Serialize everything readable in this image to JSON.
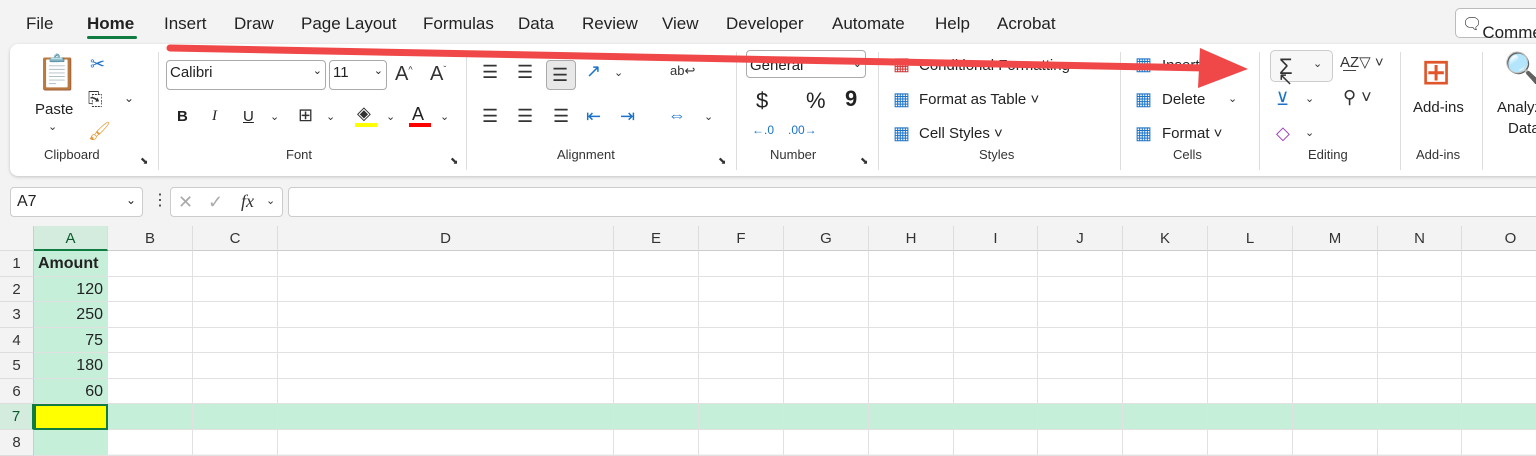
{
  "menu": {
    "tabs": [
      "File",
      "Home",
      "Insert",
      "Draw",
      "Page Layout",
      "Formulas",
      "Data",
      "Review",
      "View",
      "Developer",
      "Automate",
      "Help",
      "Acrobat"
    ],
    "active": "Home",
    "comments": "Comments"
  },
  "ribbon": {
    "clipboard": {
      "label": "Clipboard",
      "paste": "Paste"
    },
    "font": {
      "label": "Font",
      "family": "Calibri",
      "size": "11",
      "bold": "B",
      "italic": "I",
      "underline": "U",
      "font_color": "A",
      "fill_color": "#ffff00",
      "text_color": "#ff0000"
    },
    "alignment": {
      "label": "Alignment"
    },
    "number": {
      "label": "Number",
      "format": "General",
      "currency": "$",
      "percent": "%",
      "comma": "9"
    },
    "styles": {
      "label": "Styles",
      "conditional": "Conditional Formatting",
      "format_table": "Format as Table",
      "cell_styles": "Cell Styles"
    },
    "cells": {
      "label": "Cells",
      "insert": "Insert",
      "delete": "Delete",
      "format": "Format"
    },
    "editing": {
      "label": "Editing",
      "autosum": "Σ"
    },
    "addins": {
      "label": "Add-ins",
      "button": "Add-ins"
    },
    "analyze": {
      "line1": "Analyze",
      "line2": "Data"
    }
  },
  "formula_bar": {
    "name_box": "A7",
    "fx": "fx",
    "value": ""
  },
  "sheet": {
    "columns": [
      "A",
      "B",
      "C",
      "D",
      "E",
      "F",
      "G",
      "H",
      "I",
      "J",
      "K",
      "L",
      "M",
      "N",
      "O"
    ],
    "rows": [
      "1",
      "2",
      "3",
      "4",
      "5",
      "6",
      "7",
      "8"
    ],
    "cells": {
      "A1": "Amount",
      "A2": "120",
      "A3": "250",
      "A4": "75",
      "A5": "180",
      "A6": "60",
      "A7": ""
    },
    "selected_cell": "A7",
    "selected_fill": "#ffff00",
    "highlight_color": "#c6efda"
  },
  "annotation": {
    "arrow_color": "#f04848",
    "points_to": "AutoSum button"
  }
}
